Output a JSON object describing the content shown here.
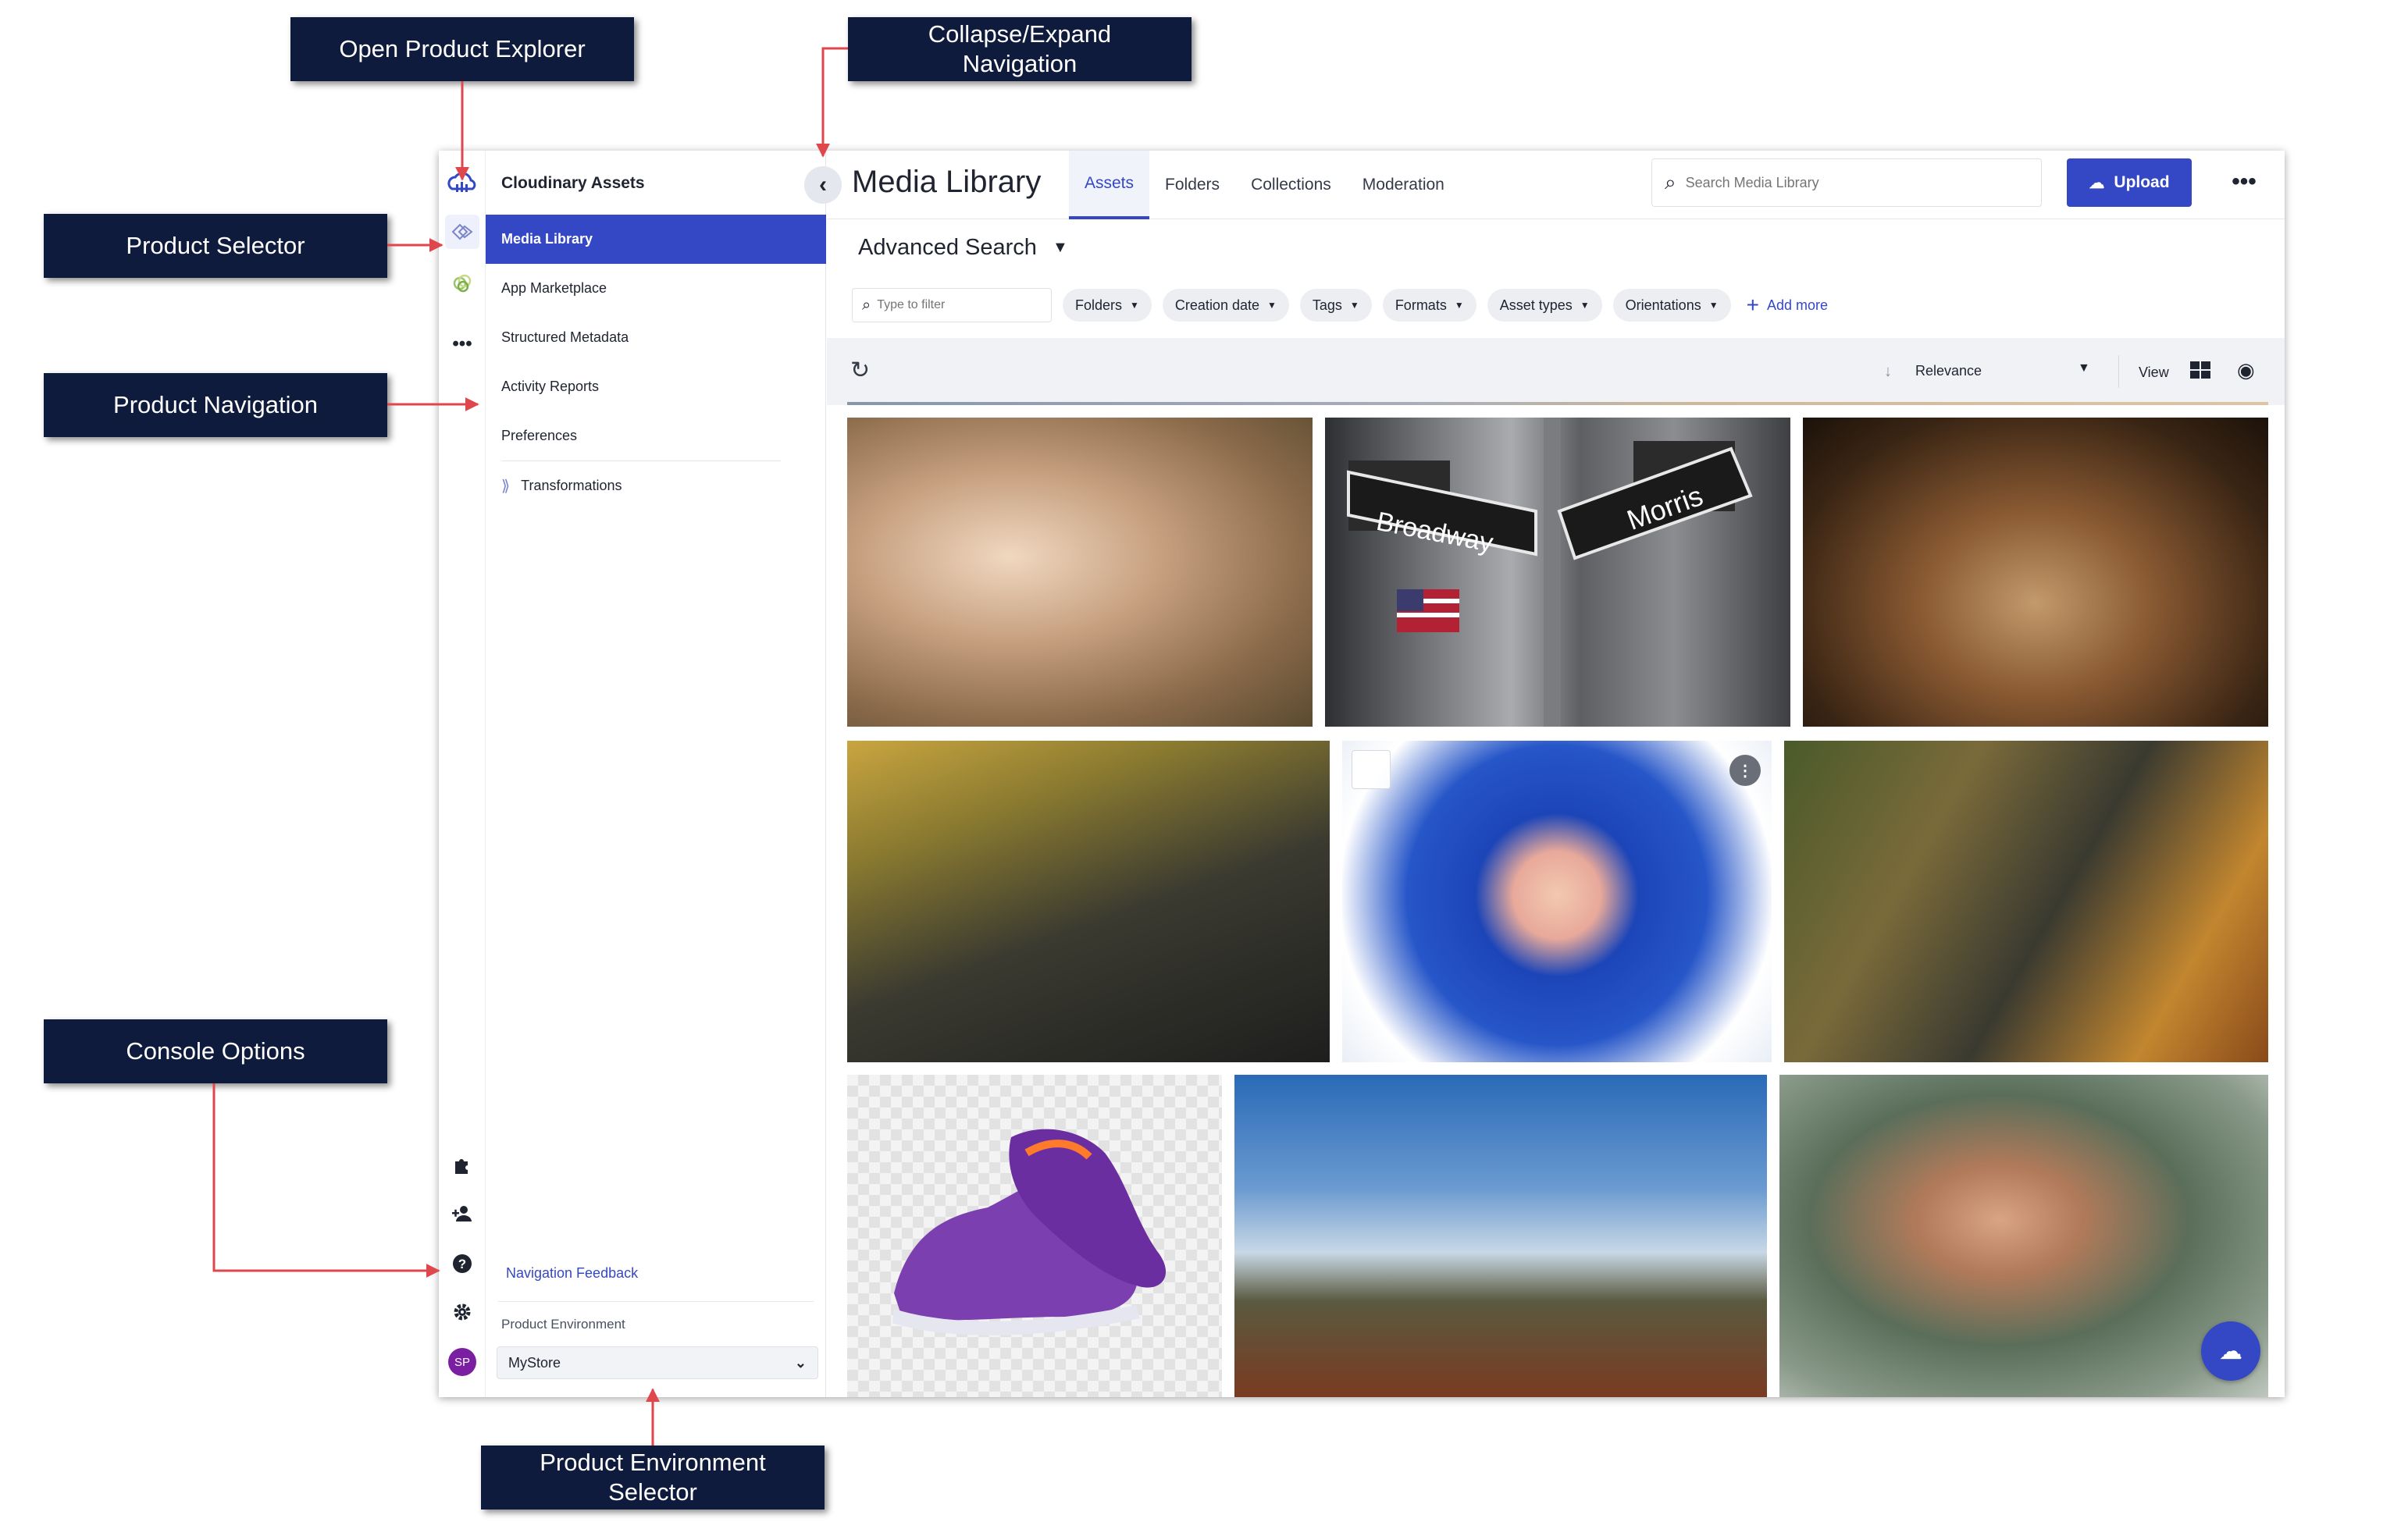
{
  "callouts": {
    "open_product_explorer": "Open Product Explorer",
    "collapse_expand": "Collapse/Expand\nNavigation",
    "product_selector": "Product Selector",
    "product_navigation": "Product Navigation",
    "console_options": "Console Options",
    "product_environment_selector": "Product Environment\nSelector"
  },
  "rail": {
    "avatar_initials": "SP"
  },
  "nav": {
    "title": "Cloudinary Assets",
    "items": [
      {
        "label": "Media Library",
        "active": true
      },
      {
        "label": "App Marketplace"
      },
      {
        "label": "Structured Metadata"
      },
      {
        "label": "Activity Reports"
      },
      {
        "label": "Preferences"
      }
    ],
    "transformations": "Transformations",
    "feedback": "Navigation Feedback",
    "environment_label": "Product Environment",
    "environment_value": "MyStore"
  },
  "header": {
    "title": "Media Library",
    "tabs": [
      "Assets",
      "Folders",
      "Collections",
      "Moderation"
    ],
    "active_tab": "Assets",
    "search_placeholder": "Search Media Library",
    "upload_label": "Upload"
  },
  "advanced_search": "Advanced Search",
  "filters": {
    "placeholder": "Type to filter",
    "chips": [
      "Folders",
      "Creation date",
      "Tags",
      "Formats",
      "Asset types",
      "Orientations"
    ],
    "add_more": "Add more"
  },
  "toolbar": {
    "sort": "Relevance",
    "view_label": "View"
  },
  "colors": {
    "accent": "#3448c5",
    "callout_bg": "#0f1b3d",
    "arrow": "#e0474c"
  }
}
